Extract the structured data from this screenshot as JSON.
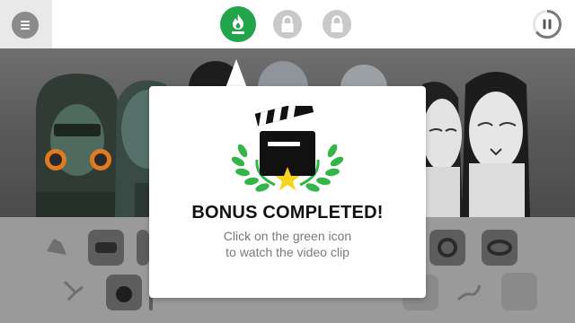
{
  "topbar": {
    "menu_icon": "hamburger-menu-icon",
    "bonus_icon": "flame-bonus-icon",
    "lock_icons": [
      "lock-icon",
      "lock-icon"
    ],
    "pause_icon": "pause-icon",
    "progress": 0.65
  },
  "popup": {
    "icon": "clapperboard-laurel-star-icon",
    "title": "BONUS COMPLETED!",
    "line1": "Click on the green icon",
    "line2": "to watch the video clip"
  },
  "colors": {
    "accent_green": "#22a44a",
    "laurel_green": "#34b54a",
    "star_yellow": "#f7d21e"
  }
}
